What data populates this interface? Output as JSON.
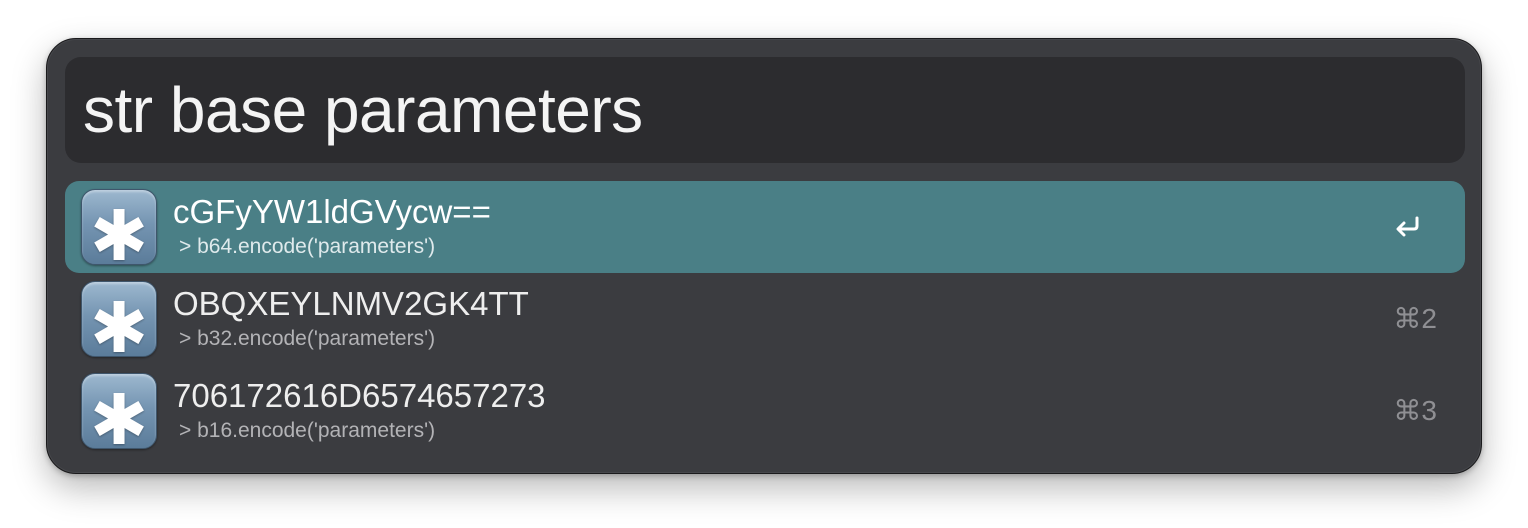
{
  "search": {
    "query": "str base parameters"
  },
  "results": [
    {
      "title": "cGFyYW1ldGVycw==",
      "subtitle": "> b64.encode('parameters')",
      "shortcut_icon": "return-icon",
      "selected": true
    },
    {
      "title": "OBQXEYLNMV2GK4TT",
      "subtitle": "> b32.encode('parameters')",
      "shortcut": "⌘2",
      "selected": false
    },
    {
      "title": "706172616D6574657273",
      "subtitle": "> b16.encode('parameters')",
      "shortcut": "⌘3",
      "selected": false
    }
  ],
  "icons": {
    "result_icon": "asterisk-icon",
    "result_glyph": "✱"
  },
  "colors": {
    "window_bg": "#3b3c40",
    "search_bg": "#2c2c2f",
    "selected_row": "#4a7f86",
    "text": "#f4f4f4",
    "subtext": "#b3b3b6"
  }
}
